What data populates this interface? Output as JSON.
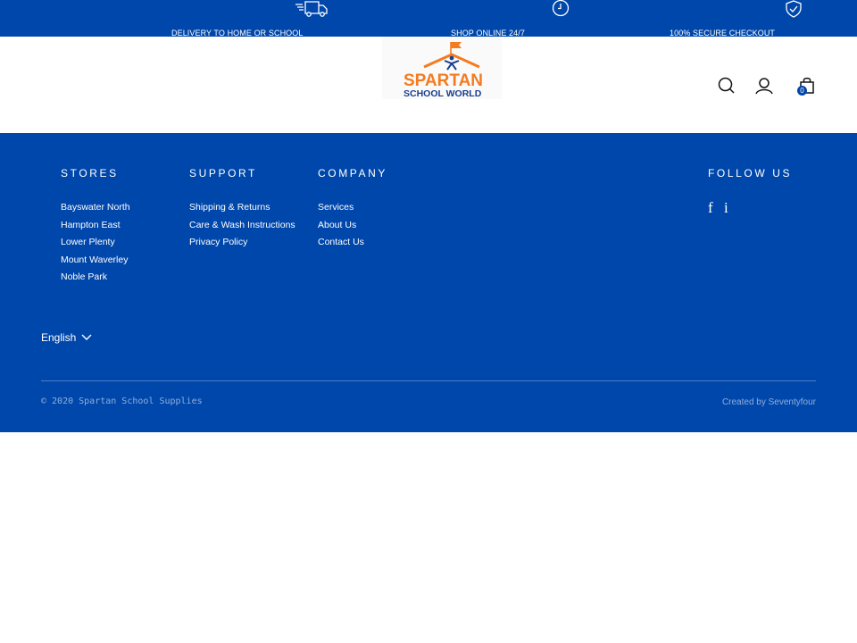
{
  "topbar": {
    "promos": [
      {
        "icon": "delivery-truck-icon",
        "label": "DELIVERY TO HOME OR SCHOOL"
      },
      {
        "icon": "clock-icon",
        "label": "SHOP ONLINE 24/7"
      },
      {
        "icon": "shield-check-icon",
        "label": "100% SECURE CHECKOUT"
      }
    ]
  },
  "header": {
    "logo": {
      "line1": "SPARTAN",
      "line2": "SCHOOL WORLD"
    },
    "icons": [
      "search-icon",
      "account-icon",
      "cart-icon"
    ],
    "cart_count": "0"
  },
  "footer": {
    "stores": {
      "title": "STORES",
      "items": [
        "Bayswater North",
        "Hampton East",
        "Lower Plenty",
        "Mount Waverley",
        "Noble Park"
      ]
    },
    "support": {
      "title": "SUPPORT",
      "items": [
        "Shipping & Returns",
        "Care & Wash Instructions",
        "Privacy Policy"
      ]
    },
    "company": {
      "title": "COMPANY",
      "items": [
        "Services",
        "About Us",
        "Contact Us"
      ]
    },
    "follow": {
      "title": "FOLLOW US",
      "facebook": "f",
      "instagram": "i"
    },
    "language": "English",
    "copyright": "© 2020 Spartan School Supplies",
    "credit": "Created by Seventyfour"
  },
  "colors": {
    "brand_blue": "#0047ab",
    "logo_orange": "#f47b20",
    "logo_navy": "#1a3f8f"
  }
}
